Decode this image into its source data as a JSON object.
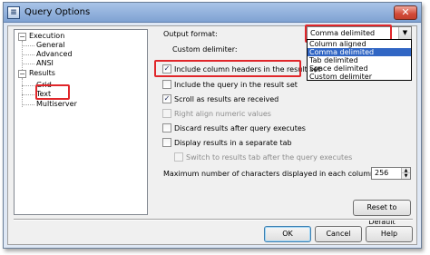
{
  "window": {
    "title": "Query Options",
    "close_glyph": "✕",
    "app_icon_glyph": "≡"
  },
  "tree": {
    "toggle_glyph": "−",
    "items": [
      {
        "label": "Execution"
      },
      {
        "label": "General"
      },
      {
        "label": "Advanced"
      },
      {
        "label": "ANSI"
      },
      {
        "label": "Results"
      },
      {
        "label": "Grid"
      },
      {
        "label": "Text"
      },
      {
        "label": "Multiserver"
      }
    ]
  },
  "form": {
    "output_format_label": "Output format:",
    "output_format_value": "Comma delimited",
    "dropdown_arrow_glyph": "▼",
    "output_format_options": [
      {
        "label": "Column aligned"
      },
      {
        "label": "Comma delimited"
      },
      {
        "label": "Tab delimited"
      },
      {
        "label": "Space delimited"
      },
      {
        "label": "Custom delimiter"
      }
    ],
    "custom_delimiter_label": "Custom delimiter:",
    "check_glyph": "✓",
    "checkboxes": [
      {
        "label": "Include column headers in the result set",
        "checked": true,
        "enabled": true
      },
      {
        "label": "Include the query in the result set",
        "checked": false,
        "enabled": true
      },
      {
        "label": "Scroll as results are received",
        "checked": true,
        "enabled": true
      },
      {
        "label": "Right align numeric values",
        "checked": false,
        "enabled": false
      },
      {
        "label": "Discard results after query executes",
        "checked": false,
        "enabled": true
      },
      {
        "label": "Display results in a separate tab",
        "checked": false,
        "enabled": true
      },
      {
        "label": "Switch to results tab after the query executes",
        "checked": false,
        "enabled": false
      }
    ],
    "max_chars_label": "Maximum number of characters displayed in each column:",
    "max_chars_value": "256",
    "spin_up_glyph": "▲",
    "spin_down_glyph": "▼",
    "reset_button": "Reset to Default"
  },
  "buttons": {
    "ok": "OK",
    "cancel": "Cancel",
    "help": "Help"
  },
  "colors": {
    "highlight": "#e0262a",
    "selection": "#3166c4",
    "titlebar": "#8fb0dd"
  }
}
